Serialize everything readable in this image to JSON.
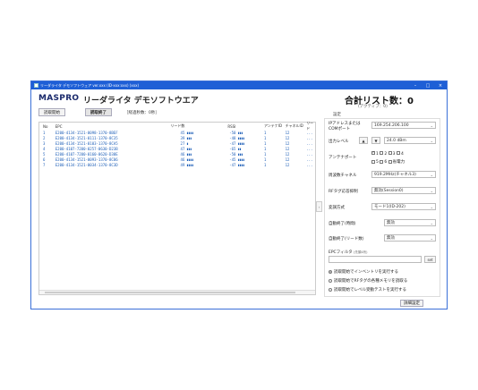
{
  "window": {
    "title": "リーダライタ デモソフトウェア ver.xxx (ID-xxx:xxx) (xxx)"
  },
  "header": {
    "logo": "MASPRO",
    "title": "リーダライタ デモソフトウエア",
    "total_label": "合計リスト数：0",
    "active_label": "(アクティブ：0)"
  },
  "toolbar": {
    "start_label": "読取開始",
    "stop_label": "読取終了",
    "elapsed": "［経過秒数：0秒］"
  },
  "table": {
    "columns": [
      "No",
      "EPC",
      "リード数",
      "",
      "RSSI",
      "",
      "アンテナID",
      "チャネルID",
      "リード"
    ],
    "rows": [
      {
        "no": "1",
        "epc": "E200-4134-1521-0098-1370-8BEF",
        "count": "45",
        "bar1": "▮▮▮▮",
        "rssi": "-50",
        "bar2": "▮▮▮",
        "ant": "1",
        "ch": "12",
        "more": "..."
      },
      {
        "no": "2",
        "epc": "E200-4134-1521-0111-1370-8C35",
        "count": "39",
        "bar1": "▮▮▮",
        "rssi": "-48",
        "bar2": "▮▮▮▮",
        "ant": "1",
        "ch": "12",
        "more": "..."
      },
      {
        "no": "3",
        "epc": "E200-4134-1521-0103-1370-8CA5",
        "count": "27",
        "bar1": "▮",
        "rssi": "-47",
        "bar2": "▮▮▮▮",
        "ant": "1",
        "ch": "12",
        "more": "..."
      },
      {
        "no": "4",
        "epc": "E200-4107-7200-0257-0630-D23B",
        "count": "47",
        "bar1": "▮▮▮",
        "rssi": "-65",
        "bar2": "▮▮",
        "ant": "1",
        "ch": "12",
        "more": "..."
      },
      {
        "no": "5",
        "epc": "E200-4107-7200-0160-0620-D38E",
        "count": "46",
        "bar1": "▮▮▮",
        "rssi": "-50",
        "bar2": "▮▮▮",
        "ant": "1",
        "ch": "12",
        "more": "..."
      },
      {
        "no": "6",
        "epc": "E200-4134-1521-0093-1370-8C86",
        "count": "46",
        "bar1": "▮▮▮▮",
        "rssi": "-45",
        "bar2": "▮▮▮▮",
        "ant": "1",
        "ch": "12",
        "more": "..."
      },
      {
        "no": "7",
        "epc": "E200-4134-1521-0034-1370-8C3D",
        "count": "49",
        "bar1": "▮▮▮▮",
        "rssi": "-47",
        "bar2": "▮▮▮▮",
        "ant": "1",
        "ch": "12",
        "more": "..."
      }
    ]
  },
  "settings": {
    "section_label": "設定",
    "ip_label": "IPアドレスまたは COMポート",
    "ip_value": "169.254.206.100",
    "power_label": "出力レベル",
    "power_value": "24.0 dBm",
    "antenna_label": "アンテナポート",
    "antenna_ports": [
      "1",
      "2",
      "3",
      "4",
      "5",
      "6",
      "省電力"
    ],
    "channel_label": "周波数チャネル",
    "channel_value": "919.2MHz(チャネル3)",
    "rf_label": "RFタグ応答抑制",
    "rf_value": "無効(Session0)",
    "modulation_label": "変調方式",
    "modulation_value": "モード1(ID-202)",
    "autostop_time_label": "自動終了(時間)",
    "autostop_time_value": "無効",
    "autostop_count_label": "自動終了(リード数)",
    "autostop_count_value": "無効",
    "filter_label": "EPCフィルタ",
    "filter_hint": "(先頭4桁)",
    "filter_set": "set",
    "radio1": "読取開始でインベントリを実行する",
    "radio2": "読取開始でRFタグの各種メモリを読取る",
    "radio3": "読取開始でレベル受動テストを実行する",
    "detail_button": "詳細設定"
  }
}
